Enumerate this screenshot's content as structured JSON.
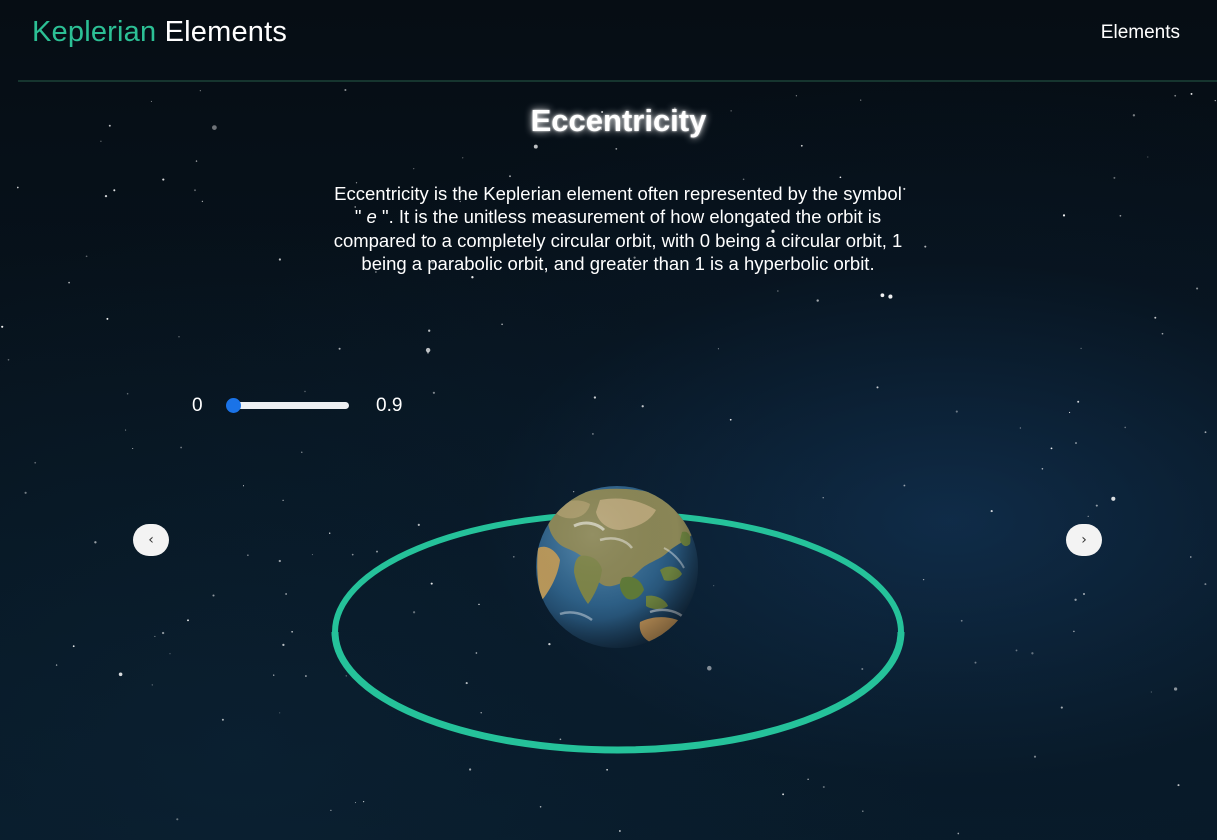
{
  "header": {
    "brand_accent": "Keplerian",
    "brand_rest": " Elements",
    "nav_link": "Elements"
  },
  "main": {
    "title": "Eccentricity",
    "description_before_symbol": "Eccentricity is the Keplerian element often represented by the symbol \"",
    "symbol": " e ",
    "description_after_symbol": "\". It is the unitless measurement of how elongated the orbit is compared to a completely circular orbit, with 0 being a circular orbit, 1 being a parabolic orbit, and greater than 1 is a hyperbolic orbit."
  },
  "slider": {
    "min_label": "0",
    "max_label": "0.9",
    "value": 0,
    "min": 0,
    "max": 0.9
  },
  "carousel": {
    "prev_label": "‹",
    "next_label": "›"
  },
  "colors": {
    "accent": "#2cc095",
    "orbit": "#25c29a",
    "slider": "#1a73e8",
    "background": "#061019"
  },
  "icons": {
    "planet": "earth-globe-icon",
    "prev": "chevron-left-icon",
    "next": "chevron-right-icon"
  }
}
